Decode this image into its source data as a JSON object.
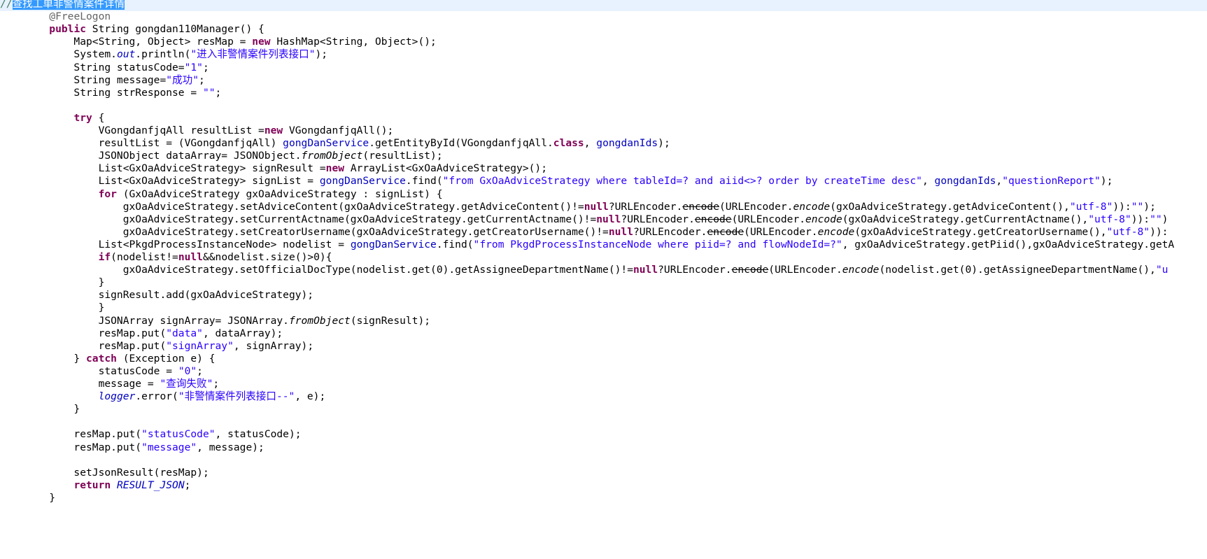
{
  "editor": {
    "lines": [
      [
        {
          "t": "//",
          "c": "comment"
        },
        {
          "t": "查找工单非警情案件详情",
          "c": "sel"
        }
      ],
      [
        {
          "t": "        ",
          "c": "plain"
        },
        {
          "t": "@FreeLogon",
          "c": "anno"
        }
      ],
      [
        {
          "t": "        ",
          "c": "plain"
        },
        {
          "t": "public",
          "c": "kw"
        },
        {
          "t": " String gongdan110Manager() {",
          "c": "plain"
        }
      ],
      [
        {
          "t": "            Map<String, Object> resMap = ",
          "c": "plain"
        },
        {
          "t": "new",
          "c": "kw"
        },
        {
          "t": " HashMap<String, Object>();",
          "c": "plain"
        }
      ],
      [
        {
          "t": "            System.",
          "c": "plain"
        },
        {
          "t": "out",
          "c": "sfield"
        },
        {
          "t": ".println(",
          "c": "plain"
        },
        {
          "t": "\"进入非警情案件列表接口\"",
          "c": "str"
        },
        {
          "t": ");",
          "c": "plain"
        }
      ],
      [
        {
          "t": "            String statusCode=",
          "c": "plain"
        },
        {
          "t": "\"1\"",
          "c": "str"
        },
        {
          "t": ";",
          "c": "plain"
        }
      ],
      [
        {
          "t": "            String message=",
          "c": "plain"
        },
        {
          "t": "\"成功\"",
          "c": "str"
        },
        {
          "t": ";",
          "c": "plain"
        }
      ],
      [
        {
          "t": "            String strResponse = ",
          "c": "plain"
        },
        {
          "t": "\"\"",
          "c": "str"
        },
        {
          "t": ";",
          "c": "plain"
        }
      ],
      [],
      [
        {
          "t": "            ",
          "c": "plain"
        },
        {
          "t": "try",
          "c": "kw"
        },
        {
          "t": " {",
          "c": "plain"
        }
      ],
      [
        {
          "t": "                VGongdanfjqAll resultList =",
          "c": "plain"
        },
        {
          "t": "new",
          "c": "kw"
        },
        {
          "t": " VGongdanfjqAll();",
          "c": "plain"
        }
      ],
      [
        {
          "t": "                resultList = (VGongdanfjqAll) ",
          "c": "plain"
        },
        {
          "t": "gongDanService",
          "c": "field"
        },
        {
          "t": ".getEntityById(VGongdanfjqAll.",
          "c": "plain"
        },
        {
          "t": "class",
          "c": "kw"
        },
        {
          "t": ", ",
          "c": "plain"
        },
        {
          "t": "gongdanIds",
          "c": "field"
        },
        {
          "t": ");",
          "c": "plain"
        }
      ],
      [
        {
          "t": "                JSONObject dataArray= JSONObject.",
          "c": "plain"
        },
        {
          "t": "fromObject",
          "c": "static"
        },
        {
          "t": "(resultList);",
          "c": "plain"
        }
      ],
      [
        {
          "t": "                List<GxOaAdviceStrategy> signResult =",
          "c": "plain"
        },
        {
          "t": "new",
          "c": "kw"
        },
        {
          "t": " ArrayList<GxOaAdviceStrategy>();",
          "c": "plain"
        }
      ],
      [
        {
          "t": "                List<GxOaAdviceStrategy> signList = ",
          "c": "plain"
        },
        {
          "t": "gongDanService",
          "c": "field"
        },
        {
          "t": ".find(",
          "c": "plain"
        },
        {
          "t": "\"from GxOaAdviceStrategy where tableId=? and aiid<>? order by createTime desc\"",
          "c": "str"
        },
        {
          "t": ", ",
          "c": "plain"
        },
        {
          "t": "gongdanIds",
          "c": "field"
        },
        {
          "t": ",",
          "c": "plain"
        },
        {
          "t": "\"questionReport\"",
          "c": "str"
        },
        {
          "t": ");",
          "c": "plain"
        }
      ],
      [
        {
          "t": "                ",
          "c": "plain"
        },
        {
          "t": "for",
          "c": "kw"
        },
        {
          "t": " (GxOaAdviceStrategy gxOaAdviceStrategy : signList) {",
          "c": "plain"
        }
      ],
      [
        {
          "t": "                    gxOaAdviceStrategy.setAdviceContent(gxOaAdviceStrategy.getAdviceContent()!=",
          "c": "plain"
        },
        {
          "t": "null",
          "c": "kw"
        },
        {
          "t": "?URLEncoder.",
          "c": "plain"
        },
        {
          "t": "encode",
          "c": "depr"
        },
        {
          "t": "(URLEncoder.",
          "c": "plain"
        },
        {
          "t": "encode",
          "c": "static"
        },
        {
          "t": "(gxOaAdviceStrategy.getAdviceContent(),",
          "c": "plain"
        },
        {
          "t": "\"utf-8\"",
          "c": "str"
        },
        {
          "t": ")):",
          "c": "plain"
        },
        {
          "t": "\"\"",
          "c": "str"
        },
        {
          "t": ");",
          "c": "plain"
        }
      ],
      [
        {
          "t": "                    gxOaAdviceStrategy.setCurrentActname(gxOaAdviceStrategy.getCurrentActname()!=",
          "c": "plain"
        },
        {
          "t": "null",
          "c": "kw"
        },
        {
          "t": "?URLEncoder.",
          "c": "plain"
        },
        {
          "t": "encode",
          "c": "depr"
        },
        {
          "t": "(URLEncoder.",
          "c": "plain"
        },
        {
          "t": "encode",
          "c": "static"
        },
        {
          "t": "(gxOaAdviceStrategy.getCurrentActname(),",
          "c": "plain"
        },
        {
          "t": "\"utf-8\"",
          "c": "str"
        },
        {
          "t": ")):",
          "c": "plain"
        },
        {
          "t": "\"\"",
          "c": "str"
        },
        {
          "t": ")",
          "c": "plain"
        }
      ],
      [
        {
          "t": "                    gxOaAdviceStrategy.setCreatorUsername(gxOaAdviceStrategy.getCreatorUsername()!=",
          "c": "plain"
        },
        {
          "t": "null",
          "c": "kw"
        },
        {
          "t": "?URLEncoder.",
          "c": "plain"
        },
        {
          "t": "encode",
          "c": "depr"
        },
        {
          "t": "(URLEncoder.",
          "c": "plain"
        },
        {
          "t": "encode",
          "c": "static"
        },
        {
          "t": "(gxOaAdviceStrategy.getCreatorUsername(),",
          "c": "plain"
        },
        {
          "t": "\"utf-8\"",
          "c": "str"
        },
        {
          "t": ")):",
          "c": "plain"
        }
      ],
      [
        {
          "t": "                List<PkgdProcessInstanceNode> nodelist = ",
          "c": "plain"
        },
        {
          "t": "gongDanService",
          "c": "field"
        },
        {
          "t": ".find(",
          "c": "plain"
        },
        {
          "t": "\"from PkgdProcessInstanceNode where piid=? and flowNodeId=?\"",
          "c": "str"
        },
        {
          "t": ", gxOaAdviceStrategy.getPiid(),gxOaAdviceStrategy.getA",
          "c": "plain"
        }
      ],
      [
        {
          "t": "                ",
          "c": "plain"
        },
        {
          "t": "if",
          "c": "kw"
        },
        {
          "t": "(nodelist!=",
          "c": "plain"
        },
        {
          "t": "null",
          "c": "kw"
        },
        {
          "t": "&&nodelist.size()>0){",
          "c": "plain"
        }
      ],
      [
        {
          "t": "                    gxOaAdviceStrategy.setOfficialDocType(nodelist.get(0).getAssigneeDepartmentName()!=",
          "c": "plain"
        },
        {
          "t": "null",
          "c": "kw"
        },
        {
          "t": "?URLEncoder.",
          "c": "plain"
        },
        {
          "t": "encode",
          "c": "depr"
        },
        {
          "t": "(URLEncoder.",
          "c": "plain"
        },
        {
          "t": "encode",
          "c": "static"
        },
        {
          "t": "(nodelist.get(0).getAssigneeDepartmentName(),",
          "c": "plain"
        },
        {
          "t": "\"u",
          "c": "str"
        }
      ],
      [
        {
          "t": "                }",
          "c": "plain"
        }
      ],
      [
        {
          "t": "                signResult.add(gxOaAdviceStrategy);",
          "c": "plain"
        }
      ],
      [
        {
          "t": "                }",
          "c": "plain"
        }
      ],
      [
        {
          "t": "                JSONArray signArray= JSONArray.",
          "c": "plain"
        },
        {
          "t": "fromObject",
          "c": "static"
        },
        {
          "t": "(signResult);",
          "c": "plain"
        }
      ],
      [
        {
          "t": "                resMap.put(",
          "c": "plain"
        },
        {
          "t": "\"data\"",
          "c": "str"
        },
        {
          "t": ", dataArray);",
          "c": "plain"
        }
      ],
      [
        {
          "t": "                resMap.put(",
          "c": "plain"
        },
        {
          "t": "\"signArray\"",
          "c": "str"
        },
        {
          "t": ", signArray);",
          "c": "plain"
        }
      ],
      [
        {
          "t": "            } ",
          "c": "plain"
        },
        {
          "t": "catch",
          "c": "kw"
        },
        {
          "t": " (Exception e) {",
          "c": "plain"
        }
      ],
      [
        {
          "t": "                statusCode = ",
          "c": "plain"
        },
        {
          "t": "\"0\"",
          "c": "str"
        },
        {
          "t": ";",
          "c": "plain"
        }
      ],
      [
        {
          "t": "                message = ",
          "c": "plain"
        },
        {
          "t": "\"查询失败\"",
          "c": "str"
        },
        {
          "t": ";",
          "c": "plain"
        }
      ],
      [
        {
          "t": "                ",
          "c": "plain"
        },
        {
          "t": "logger",
          "c": "sfield"
        },
        {
          "t": ".error(",
          "c": "plain"
        },
        {
          "t": "\"非警情案件列表接口--\"",
          "c": "str"
        },
        {
          "t": ", e);",
          "c": "plain"
        }
      ],
      [
        {
          "t": "            }",
          "c": "plain"
        }
      ],
      [],
      [
        {
          "t": "            resMap.put(",
          "c": "plain"
        },
        {
          "t": "\"statusCode\"",
          "c": "str"
        },
        {
          "t": ", statusCode);",
          "c": "plain"
        }
      ],
      [
        {
          "t": "            resMap.put(",
          "c": "plain"
        },
        {
          "t": "\"message\"",
          "c": "str"
        },
        {
          "t": ", message);",
          "c": "plain"
        }
      ],
      [],
      [
        {
          "t": "            setJsonResult(resMap);",
          "c": "plain"
        }
      ],
      [
        {
          "t": "            ",
          "c": "plain"
        },
        {
          "t": "return",
          "c": "kw"
        },
        {
          "t": " ",
          "c": "plain"
        },
        {
          "t": "RESULT_JSON",
          "c": "sfield"
        },
        {
          "t": ";",
          "c": "plain"
        }
      ],
      [
        {
          "t": "        }",
          "c": "plain"
        }
      ]
    ],
    "theme": {
      "keyword": "#7f0055",
      "string": "#2a00ff",
      "field": "#0000c0",
      "comment": "#3f7f5f",
      "annotation": "#646464",
      "selection": "#3399ff",
      "current_line": "#e8f2fe"
    }
  }
}
